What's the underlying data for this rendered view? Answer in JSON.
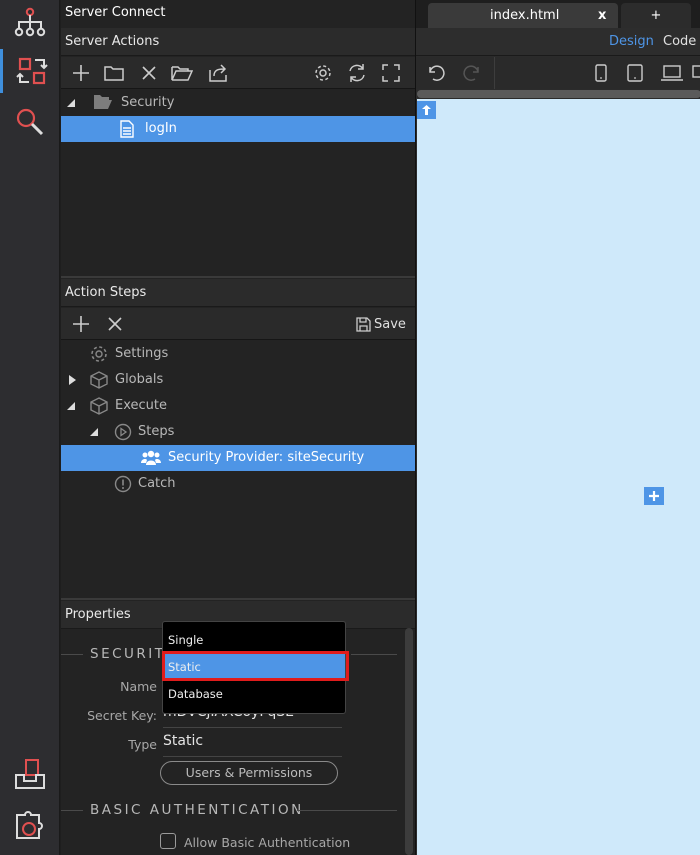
{
  "app": {
    "title": "Server Connect"
  },
  "rail": {
    "items": [
      {
        "name": "sitemap-icon"
      },
      {
        "name": "server-connect-icon"
      },
      {
        "name": "search-icon"
      },
      {
        "name": "inbox-icon"
      },
      {
        "name": "extensions-icon"
      }
    ]
  },
  "server_actions": {
    "header": "Server Actions",
    "tree": [
      {
        "label": "Security",
        "type": "folder",
        "expanded": true
      },
      {
        "label": "logIn",
        "type": "file",
        "selected": true
      }
    ]
  },
  "action_steps": {
    "header": "Action Steps",
    "save_label": "Save",
    "tree": [
      {
        "label": "Settings"
      },
      {
        "label": "Globals"
      },
      {
        "label": "Execute"
      },
      {
        "label": "Steps"
      },
      {
        "label": "Security Provider: siteSecurity",
        "selected": true
      },
      {
        "label": "Catch"
      }
    ]
  },
  "properties": {
    "header": "Properties",
    "section_security": "SECURITY",
    "name_label": "Name",
    "secret_key_label": "Secret Key:",
    "secret_key_value": "mDVCjIAXCoyFqSE",
    "type_label": "Type",
    "type_value": "Static",
    "users_permissions_button": "Users & Permissions",
    "section_basic_auth": "BASIC AUTHENTICATION",
    "allow_basic_auth_label": "Allow Basic Authentication",
    "allow_basic_auth_checked": false
  },
  "type_dropdown": {
    "options": [
      "Single",
      "Static",
      "Database"
    ],
    "selected": "Static"
  },
  "editor": {
    "tabs": [
      {
        "label": "index.html",
        "close": "x"
      },
      {
        "label": "+"
      }
    ],
    "modes": {
      "design": "Design",
      "code": "Code",
      "active": "Design"
    }
  },
  "colors": {
    "accent": "#4e95e6",
    "canvas": "#cfe9fa",
    "highlight": "#e01c1c"
  }
}
